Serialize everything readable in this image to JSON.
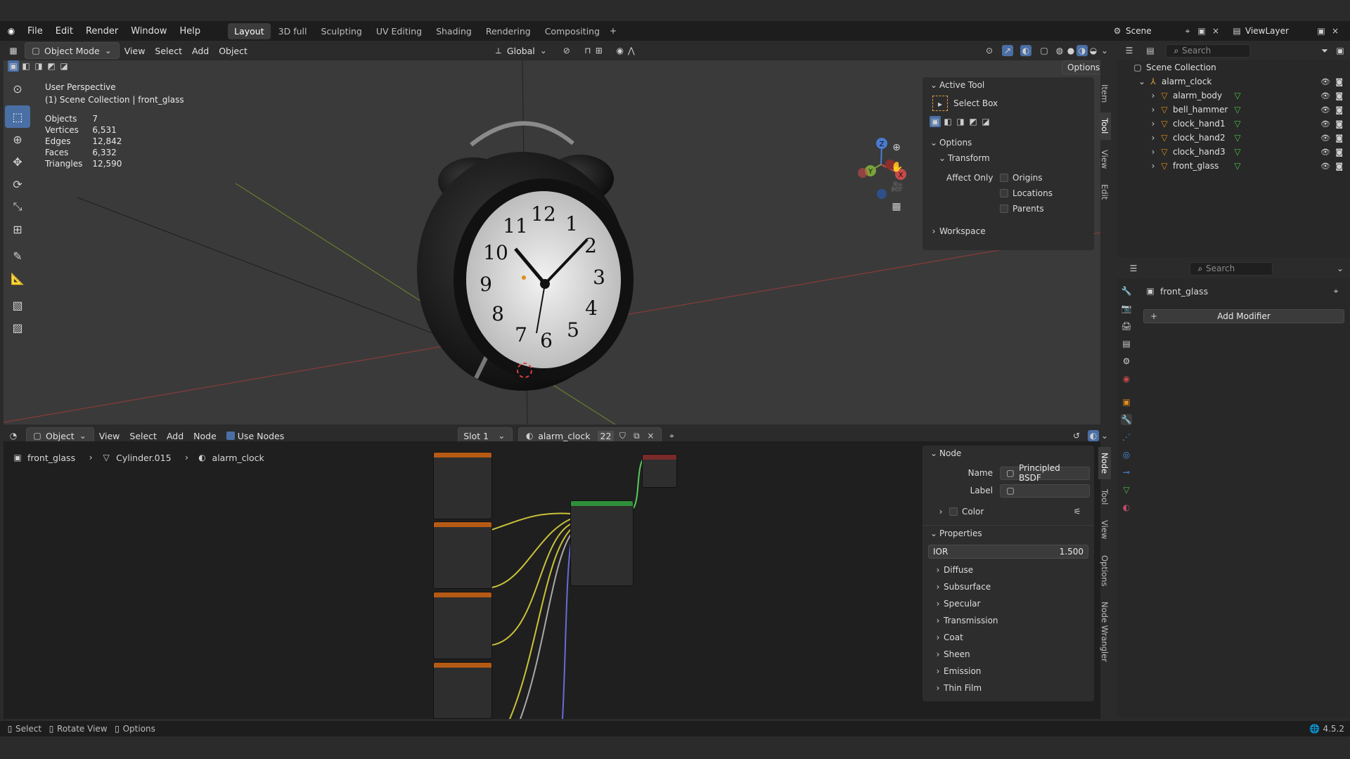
{
  "menu": {
    "items": [
      "File",
      "Edit",
      "Render",
      "Window",
      "Help"
    ],
    "workspaces": [
      "Layout",
      "3D full",
      "Sculpting",
      "UV Editing",
      "Shading",
      "Rendering",
      "Compositing"
    ],
    "active_workspace": "Layout",
    "scene": "Scene",
    "view_layer": "ViewLayer"
  },
  "viewport_header": {
    "mode": "Object Mode",
    "menus": [
      "View",
      "Select",
      "Add",
      "Object"
    ],
    "orientation": "Global",
    "options": "Options"
  },
  "viewport": {
    "perspective": "User Perspective",
    "collection_line": "(1) Scene Collection | front_glass",
    "stats": [
      {
        "label": "Objects",
        "value": "7"
      },
      {
        "label": "Vertices",
        "value": "6,531"
      },
      {
        "label": "Edges",
        "value": "12,842"
      },
      {
        "label": "Faces",
        "value": "6,332"
      },
      {
        "label": "Triangles",
        "value": "12,590"
      }
    ],
    "clock_numbers": [
      "12",
      "1",
      "2",
      "3",
      "4",
      "5",
      "6",
      "7",
      "8",
      "9",
      "10",
      "11"
    ],
    "gizmo": {
      "z": "Z",
      "y": "Y",
      "x": "X"
    }
  },
  "npanel_tool": {
    "active_tool_title": "Active Tool",
    "active_tool_name": "Select Box",
    "options_title": "Options",
    "transform_title": "Transform",
    "affect_only": "Affect Only",
    "affect_items": [
      "Origins",
      "Locations",
      "Parents"
    ],
    "workspace_title": "Workspace",
    "tabs": [
      "Item",
      "Tool",
      "View",
      "Edit"
    ]
  },
  "node_header": {
    "type": "Object",
    "menus": [
      "View",
      "Select",
      "Add",
      "Node"
    ],
    "use_nodes": "Use Nodes",
    "slot": "Slot 1",
    "material": "alarm_clock",
    "users": "22"
  },
  "node_breadcrumb": {
    "object": "front_glass",
    "mesh": "Cylinder.015",
    "material": "alarm_clock"
  },
  "node_panel": {
    "node_title": "Node",
    "name_label": "Name",
    "name_value": "Principled BSDF",
    "label_label": "Label",
    "label_value": "",
    "color_title": "Color",
    "properties_title": "Properties",
    "ior_label": "IOR",
    "ior_value": "1.500",
    "sections": [
      "Diffuse",
      "Subsurface",
      "Specular",
      "Transmission",
      "Coat",
      "Sheen",
      "Emission",
      "Thin Film"
    ],
    "tabs": [
      "Node",
      "Tool",
      "View",
      "Options",
      "Node Wrangler"
    ]
  },
  "outliner": {
    "search_placeholder": "Search",
    "root": "Scene Collection",
    "collection": "alarm_clock",
    "objects": [
      "alarm_body",
      "bell_hammer",
      "clock_hand1",
      "clock_hand2",
      "clock_hand3",
      "front_glass"
    ]
  },
  "properties": {
    "search_placeholder": "Search",
    "object": "front_glass",
    "add_modifier": "Add Modifier"
  },
  "statusbar": {
    "items": [
      "Select",
      "Rotate View",
      "Options"
    ],
    "version": "4.5.2"
  },
  "colors": {
    "accent": "#4a6fa5",
    "node_orange": "#b55a14",
    "node_green": "#2f8f3a",
    "node_red": "#7a2a2a",
    "wire_yellow": "#c9c23a",
    "wire_purple": "#6a6ad8",
    "wire_green": "#5ac85a"
  }
}
